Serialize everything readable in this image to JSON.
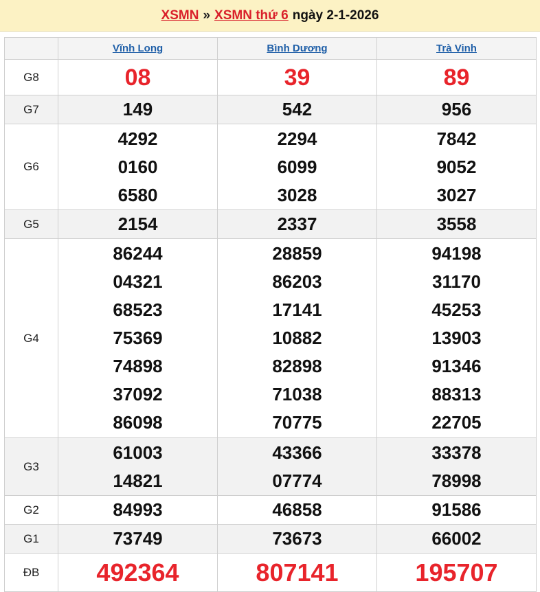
{
  "header": {
    "link1": "XSMN",
    "separator": "»",
    "link2": "XSMN thứ 6",
    "date_text": "ngày 2-1-2026"
  },
  "provinces": [
    "Vĩnh Long",
    "Bình Dương",
    "Trà Vinh"
  ],
  "prizes": [
    {
      "label": "G8",
      "style": "red",
      "values": [
        [
          "08"
        ],
        [
          "39"
        ],
        [
          "89"
        ]
      ]
    },
    {
      "label": "G7",
      "style": "normal",
      "values": [
        [
          "149"
        ],
        [
          "542"
        ],
        [
          "956"
        ]
      ]
    },
    {
      "label": "G6",
      "style": "normal",
      "values": [
        [
          "4292",
          "0160",
          "6580"
        ],
        [
          "2294",
          "6099",
          "3028"
        ],
        [
          "7842",
          "9052",
          "3027"
        ]
      ]
    },
    {
      "label": "G5",
      "style": "normal",
      "values": [
        [
          "2154"
        ],
        [
          "2337"
        ],
        [
          "3558"
        ]
      ]
    },
    {
      "label": "G4",
      "style": "normal",
      "values": [
        [
          "86244",
          "04321",
          "68523",
          "75369",
          "74898",
          "37092",
          "86098"
        ],
        [
          "28859",
          "86203",
          "17141",
          "10882",
          "82898",
          "71038",
          "70775"
        ],
        [
          "94198",
          "31170",
          "45253",
          "13903",
          "91346",
          "88313",
          "22705"
        ]
      ]
    },
    {
      "label": "G3",
      "style": "normal",
      "values": [
        [
          "61003",
          "14821"
        ],
        [
          "43366",
          "07774"
        ],
        [
          "33378",
          "78998"
        ]
      ]
    },
    {
      "label": "G2",
      "style": "normal",
      "values": [
        [
          "84993"
        ],
        [
          "46858"
        ],
        [
          "91586"
        ]
      ]
    },
    {
      "label": "G1",
      "style": "normal",
      "values": [
        [
          "73749"
        ],
        [
          "73673"
        ],
        [
          "66002"
        ]
      ]
    },
    {
      "label": "ĐB",
      "style": "special",
      "values": [
        [
          "492364"
        ],
        [
          "807141"
        ],
        [
          "195707"
        ]
      ]
    }
  ],
  "colors": {
    "header_bg": "#fcf2c4",
    "link_red": "#d9202a",
    "province_link": "#1f5fa8",
    "highlight_red": "#e8242b",
    "alt_row_bg": "#f2f2f2"
  }
}
